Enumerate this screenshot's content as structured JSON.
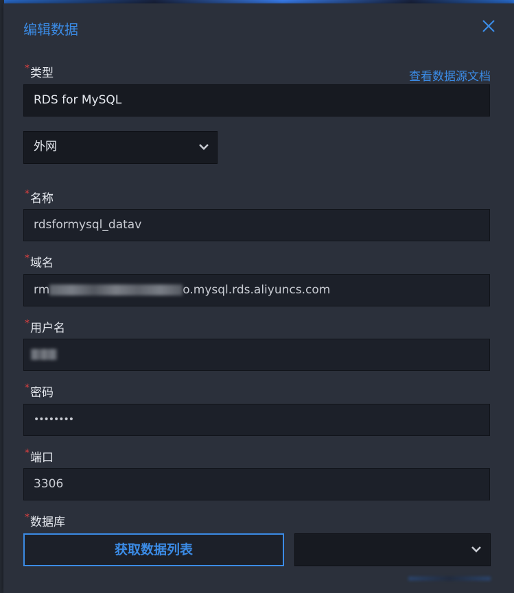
{
  "modal": {
    "title": "编辑数据",
    "doc_link": "查看数据源文档"
  },
  "form": {
    "type": {
      "label": "类型",
      "value": "RDS for MySQL"
    },
    "network": {
      "value": "外网"
    },
    "name": {
      "label": "名称",
      "value": "rdsformysql_datav"
    },
    "host": {
      "label": "域名",
      "prefix": "rm",
      "suffix": "o.mysql.rds.aliyuncs.com"
    },
    "username": {
      "label": "用户名"
    },
    "password": {
      "label": "密码",
      "value": "••••••••"
    },
    "port": {
      "label": "端口",
      "value": "3306"
    },
    "database": {
      "label": "数据库",
      "fetch_button": "获取数据列表",
      "select_value": ""
    }
  },
  "colors": {
    "accent": "#3b8be5",
    "required": "#e04040",
    "panel": "#2b303b"
  },
  "icons": {
    "close": "close-icon",
    "dropdown": "chevron-down-icon"
  }
}
